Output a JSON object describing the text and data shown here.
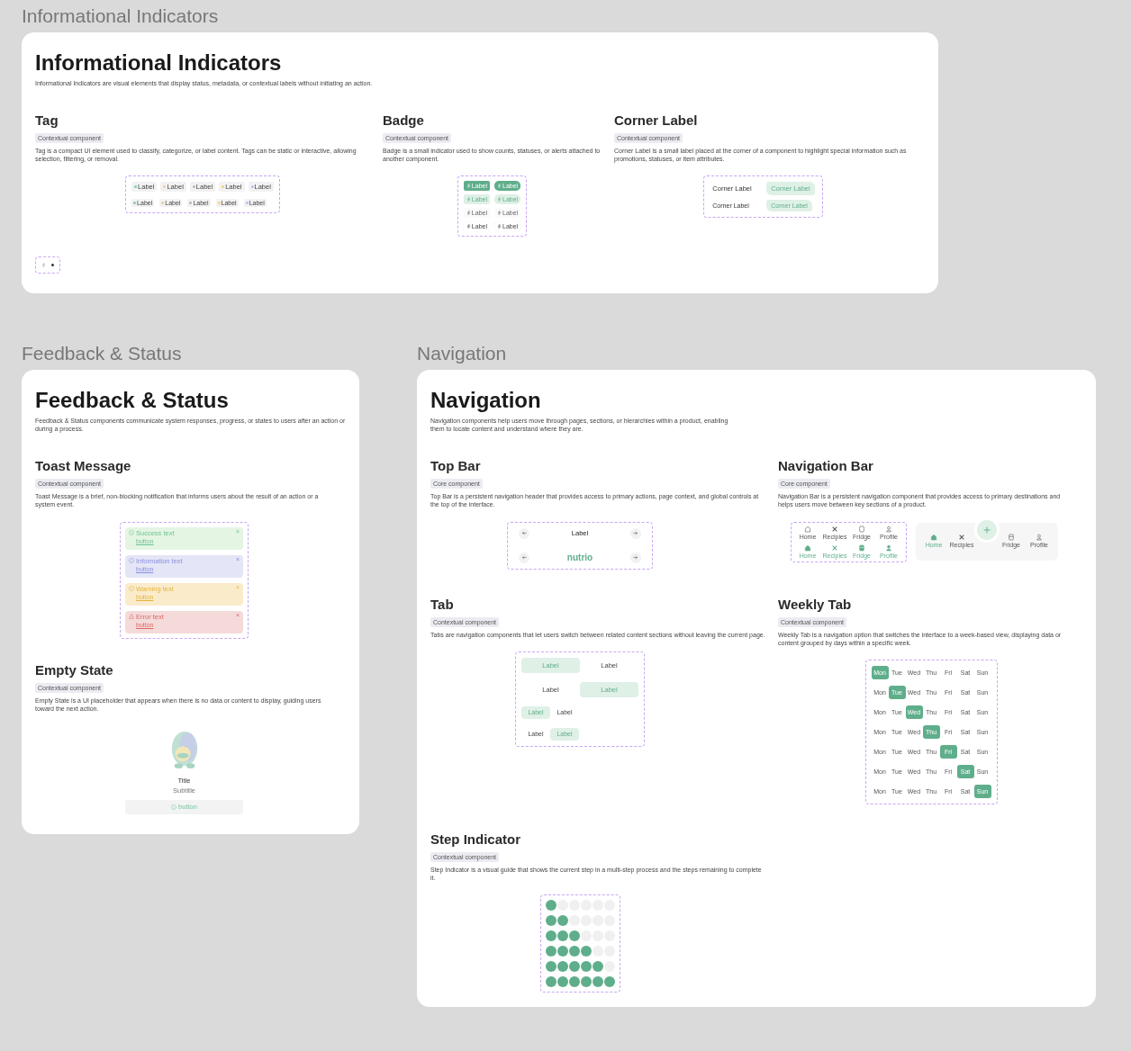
{
  "sections": [
    {
      "label": "Informational Indicators",
      "title": "Informational Indicators",
      "description": "Informational Indicators are visual elements that display status, metadata, or contextual labels without initiating an action.",
      "components": [
        {
          "kind": "tag",
          "title": "Tag",
          "badge": "Contextual component",
          "description": "Tag is a compact UI element used to classify, categorize, or label content. Tags can be static or interactive, allowing selection, filtering, or removal.",
          "rows": [
            {
              "tags": [
                {
                  "label": "Label",
                  "color": "#7ccfa6"
                },
                {
                  "label": "Label",
                  "color": "#f3c9a0"
                },
                {
                  "label": "Label",
                  "color": "#b8b8b8"
                },
                {
                  "label": "Label",
                  "color": "#f2d27c"
                },
                {
                  "label": "Label",
                  "color": "#c9b5f5"
                }
              ]
            },
            {
              "tags": [
                {
                  "label": "Label",
                  "color": "#7ccfa6"
                },
                {
                  "label": "Label",
                  "color": "#f3c9a0"
                },
                {
                  "label": "Label",
                  "color": "#b8b8b8"
                },
                {
                  "label": "Label",
                  "color": "#f2d27c"
                },
                {
                  "label": "Label",
                  "color": "#c9b5f5"
                }
              ]
            }
          ]
        },
        {
          "kind": "badge",
          "title": "Badge",
          "badge": "Contextual component",
          "description": "Badge is a small indicator used to show counts, statuses, or alerts attached to another component.",
          "rows": [
            {
              "badges": [
                "Label",
                "Label"
              ]
            },
            {
              "badges": [
                "Label",
                "Label"
              ]
            },
            {
              "badges": [
                "Label",
                "Label"
              ]
            },
            {
              "badges": [
                "Label",
                "Label"
              ]
            }
          ]
        },
        {
          "kind": "corner",
          "title": "Corner Label",
          "badge": "Contextual component",
          "description": "Corner Label is a small label placed at the corner of a component to highlight special information such as promotions, statuses, or item attributes.",
          "rows": [
            {
              "text": "Corner Label",
              "label": "Corner Label"
            },
            {
              "text": "Corner Label",
              "label": "Corner Label"
            }
          ]
        }
      ]
    },
    {
      "label": "Feedback & Status",
      "title": "Feedback & Status",
      "description": "Feedback & Status components communicate system responses, progress, or states to users after an action or during a process.",
      "components": [
        {
          "kind": "toast",
          "title": "Toast Message",
          "badge": "Contextual component",
          "description": "Toast Message is a brief, non-blocking notification that informs users about the result of an action or a system event.",
          "toasts": [
            {
              "kind": "success",
              "text": "Success text",
              "action": "button",
              "close": "×"
            },
            {
              "kind": "info",
              "text": "Information text",
              "action": "button",
              "close": "×"
            },
            {
              "kind": "warning",
              "text": "Warning text",
              "action": "button",
              "close": "×"
            },
            {
              "kind": "error",
              "text": "Error text",
              "action": "button",
              "close": "×"
            }
          ]
        },
        {
          "kind": "empty",
          "title": "Empty State",
          "badge": "Contextual component",
          "description": "Empty State is a UI placeholder that appears when there is no data or content to display, guiding users toward the next action.",
          "empty": {
            "title": "Title",
            "subtitle": "Subtitle",
            "button": "button"
          }
        }
      ]
    },
    {
      "label": "Navigation",
      "title": "Navigation",
      "description": "Navigation components help users move through pages, sections, or hierarchies within a product, enabling them to locate content and understand where they are.",
      "components": [
        {
          "kind": "topbar",
          "title": "Top Bar",
          "badge": "Core component",
          "description": "Top Bar is a persistent navigation header that provides access to primary actions, page context, and global controls at the top of the interface.",
          "rows": [
            {
              "kind": "title",
              "text": "Label"
            },
            {
              "kind": "logo",
              "text": "nutrio"
            }
          ]
        },
        {
          "kind": "navbar",
          "title": "Navigation Bar",
          "badge": "Core component",
          "description": "Navigation Bar is a persistent navigation component that provides access to primary destinations and helps users move between key sections of a product.",
          "bars": [
            {
              "kind": "compact",
              "items": [
                {
                  "label": "Home",
                  "selected": false
                },
                {
                  "label": "Recipies",
                  "selected": false
                },
                {
                  "label": "Fridge",
                  "selected": false
                },
                {
                  "label": "Profile",
                  "selected": false
                }
              ]
            },
            {
              "kind": "compact",
              "items": [
                {
                  "label": "Home",
                  "selected": true
                },
                {
                  "label": "Recipies",
                  "selected": true
                },
                {
                  "label": "Fridge",
                  "selected": true
                },
                {
                  "label": "Profile",
                  "selected": true
                }
              ]
            },
            {
              "kind": "floating",
              "items": [
                {
                  "label": "Home",
                  "selected": true
                },
                {
                  "label": "Recipies",
                  "selected": false
                },
                {
                  "label": "Fridge",
                  "selected": false
                },
                {
                  "label": "Profile",
                  "selected": false
                }
              ]
            }
          ]
        },
        {
          "kind": "tab",
          "title": "Tab",
          "badge": "Contextual component",
          "description": "Tabs are navigation components that let users switch between related content sections without leaving the current page.",
          "rows": [
            {
              "tabs": [
                {
                  "label": "Label",
                  "selected": true
                },
                {
                  "label": "Label",
                  "selected": false
                }
              ]
            },
            {
              "tabs": [
                {
                  "label": "Label",
                  "selected": false
                },
                {
                  "label": "Label",
                  "selected": true
                }
              ]
            },
            {
              "tabs": [
                {
                  "label": "Label",
                  "selected": true
                },
                {
                  "label": "Label",
                  "selected": false
                }
              ]
            },
            {
              "tabs": [
                {
                  "label": "Label",
                  "selected": false
                },
                {
                  "label": "Label",
                  "selected": true
                }
              ]
            }
          ]
        },
        {
          "kind": "weekly",
          "title": "Weekly Tab",
          "badge": "Contextual component",
          "description": "Weekly Tab is a navigation option that switches the interface to a week-based view, displaying data or content grouped by days within a specific week.",
          "weeks": [
            [
              {
                "label": "Mon",
                "selected": true
              },
              {
                "label": "Tue",
                "selected": false
              },
              {
                "label": "Wed",
                "selected": false
              },
              {
                "label": "Thu",
                "selected": false
              },
              {
                "label": "Fri",
                "selected": false
              },
              {
                "label": "Sat",
                "selected": false
              },
              {
                "label": "Sun",
                "selected": false
              }
            ],
            [
              {
                "label": "Mon",
                "selected": false
              },
              {
                "label": "Tue",
                "selected": true
              },
              {
                "label": "Wed",
                "selected": false
              },
              {
                "label": "Thu",
                "selected": false
              },
              {
                "label": "Fri",
                "selected": false
              },
              {
                "label": "Sat",
                "selected": false
              },
              {
                "label": "Sun",
                "selected": false
              }
            ],
            [
              {
                "label": "Mon",
                "selected": false
              },
              {
                "label": "Tue",
                "selected": false
              },
              {
                "label": "Wed",
                "selected": true
              },
              {
                "label": "Thu",
                "selected": false
              },
              {
                "label": "Fri",
                "selected": false
              },
              {
                "label": "Sat",
                "selected": false
              },
              {
                "label": "Sun",
                "selected": false
              }
            ],
            [
              {
                "label": "Mon",
                "selected": false
              },
              {
                "label": "Tue",
                "selected": false
              },
              {
                "label": "Wed",
                "selected": false
              },
              {
                "label": "Thu",
                "selected": true
              },
              {
                "label": "Fri",
                "selected": false
              },
              {
                "label": "Sat",
                "selected": false
              },
              {
                "label": "Sun",
                "selected": false
              }
            ],
            [
              {
                "label": "Mon",
                "selected": false
              },
              {
                "label": "Tue",
                "selected": false
              },
              {
                "label": "Wed",
                "selected": false
              },
              {
                "label": "Thu",
                "selected": false
              },
              {
                "label": "Fri",
                "selected": true
              },
              {
                "label": "Sat",
                "selected": false
              },
              {
                "label": "Sun",
                "selected": false
              }
            ],
            [
              {
                "label": "Mon",
                "selected": false
              },
              {
                "label": "Tue",
                "selected": false
              },
              {
                "label": "Wed",
                "selected": false
              },
              {
                "label": "Thu",
                "selected": false
              },
              {
                "label": "Fri",
                "selected": false
              },
              {
                "label": "Sat",
                "selected": true
              },
              {
                "label": "Sun",
                "selected": false
              }
            ],
            [
              {
                "label": "Mon",
                "selected": false
              },
              {
                "label": "Tue",
                "selected": false
              },
              {
                "label": "Wed",
                "selected": false
              },
              {
                "label": "Thu",
                "selected": false
              },
              {
                "label": "Fri",
                "selected": false
              },
              {
                "label": "Sat",
                "selected": false
              },
              {
                "label": "Sun",
                "selected": true
              }
            ]
          ]
        },
        {
          "kind": "steps",
          "title": "Step Indicator",
          "badge": "Contextual component",
          "description": "Step Indicator is a visual guide that shows the current step in a multi-step process and the steps remaining to complete it.",
          "rows": [
            [
              {
                "done": true
              },
              {
                "done": false
              },
              {
                "done": false
              },
              {
                "done": false
              },
              {
                "done": false
              },
              {
                "done": false
              }
            ],
            [
              {
                "done": true
              },
              {
                "done": true
              },
              {
                "done": false
              },
              {
                "done": false
              },
              {
                "done": false
              },
              {
                "done": false
              }
            ],
            [
              {
                "done": true
              },
              {
                "done": true
              },
              {
                "done": true
              },
              {
                "done": false
              },
              {
                "done": false
              },
              {
                "done": false
              }
            ],
            [
              {
                "done": true
              },
              {
                "done": true
              },
              {
                "done": true
              },
              {
                "done": true
              },
              {
                "done": false
              },
              {
                "done": false
              }
            ],
            [
              {
                "done": true
              },
              {
                "done": true
              },
              {
                "done": true
              },
              {
                "done": true
              },
              {
                "done": true
              },
              {
                "done": false
              }
            ],
            [
              {
                "done": true
              },
              {
                "done": true
              },
              {
                "done": true
              },
              {
                "done": true
              },
              {
                "done": true
              },
              {
                "done": true
              }
            ]
          ]
        }
      ]
    }
  ]
}
